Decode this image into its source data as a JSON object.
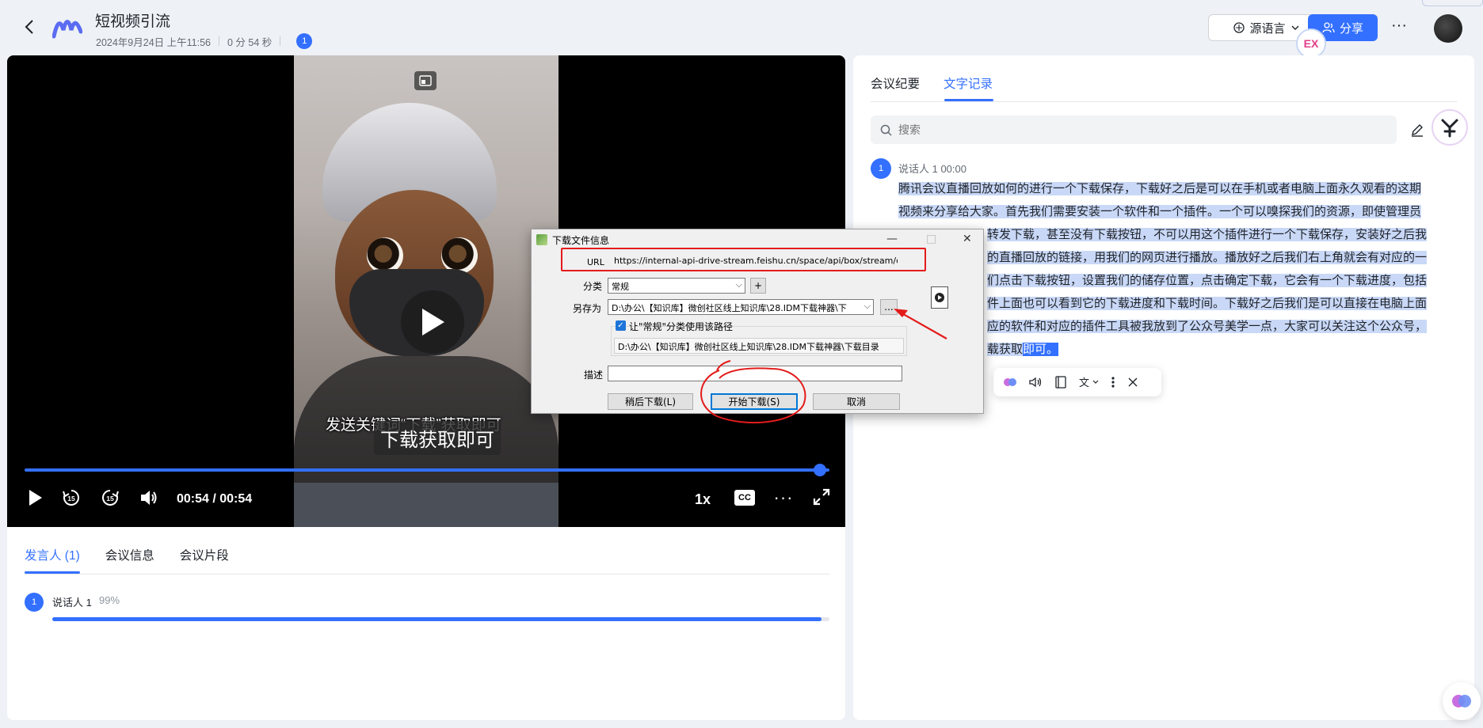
{
  "header": {
    "title": "短视频引流",
    "date": "2024年9月24日 上午11:56",
    "duration": "0 分 54 秒",
    "participant_count": "1",
    "lang_button": "源语言",
    "share_button": "分享",
    "ex_badge": "EX"
  },
  "video": {
    "subtitle_background": "发送关键词“下载”获取即可",
    "subtitle": "下载获取即可",
    "time": "00:54 / 00:54",
    "speed": "1x",
    "rewind_label": "15",
    "forward_label": "15",
    "cc_label": "CC",
    "progress": 1.0
  },
  "speakers_panel": {
    "tabs": [
      "发言人 (1)",
      "会议信息",
      "会议片段"
    ],
    "active_tab": 0,
    "speaker_avatar": "1",
    "speaker_name": "说话人 1",
    "speaker_pct": "99%",
    "speaker_share": 0.99
  },
  "transcript_panel": {
    "tabs": [
      "会议纪要",
      "文字记录"
    ],
    "active_tab": 1,
    "search_placeholder": "搜索",
    "speaker_avatar": "1",
    "speaker_head": "说话人 1  00:00",
    "lines": [
      "腾讯会议直播回放如何的进行一个下载保存，下载好之后是可以在手机或者电脑上面永久观看的这期",
      "视频来分享给大家。首先我们需要安装一个软件和一个插件。一个可以嗅探我们的资源，即使管理员",
      "转发下载，甚至没有下载按钮，不可以用这个插件进行一个下载保存，安装好之后我",
      "的直播回放的链接，用我们的网页进行播放。播放好之后我们右上角就会有对应的一",
      "们点击下载按钮，设置我们的储存位置，点击确定下载，它会有一个下载进度，包括",
      "件上面也可以看到它的下载进度和下载时间。下载好之后我们是可以直接在电脑上面",
      "应的软件和对应的插件工具被我放到了公众号美学一点，大家可以关注这个公众号，"
    ],
    "last_line_prefix": "载获取",
    "last_line_selected": "即可。"
  },
  "idm_dialog": {
    "title": "下载文件信息",
    "url_label": "URL",
    "url_value": "https://internal-api-drive-stream.feishu.cn/space/api/box/stream/downloac",
    "category_label": "分类",
    "category_value": "常规",
    "add_button": "+",
    "saveas_label": "另存为",
    "saveas_value": "D:\\办公\\【知识库】微创社区线上知识库\\28.IDM下载神器\\下",
    "browse_button": "...",
    "checkbox_label": "让\"常规\"分类使用该路径",
    "path_value": "D:\\办公\\【知识库】微创社区线上知识库\\28.IDM下载神器\\下载目录",
    "desc_label": "描述",
    "later_button": "稍后下载(L)",
    "start_button": "开始下载(S)",
    "cancel_button": "取消"
  },
  "colors": {
    "accent": "#3370ff",
    "annotation_red": "#e31b1b"
  }
}
